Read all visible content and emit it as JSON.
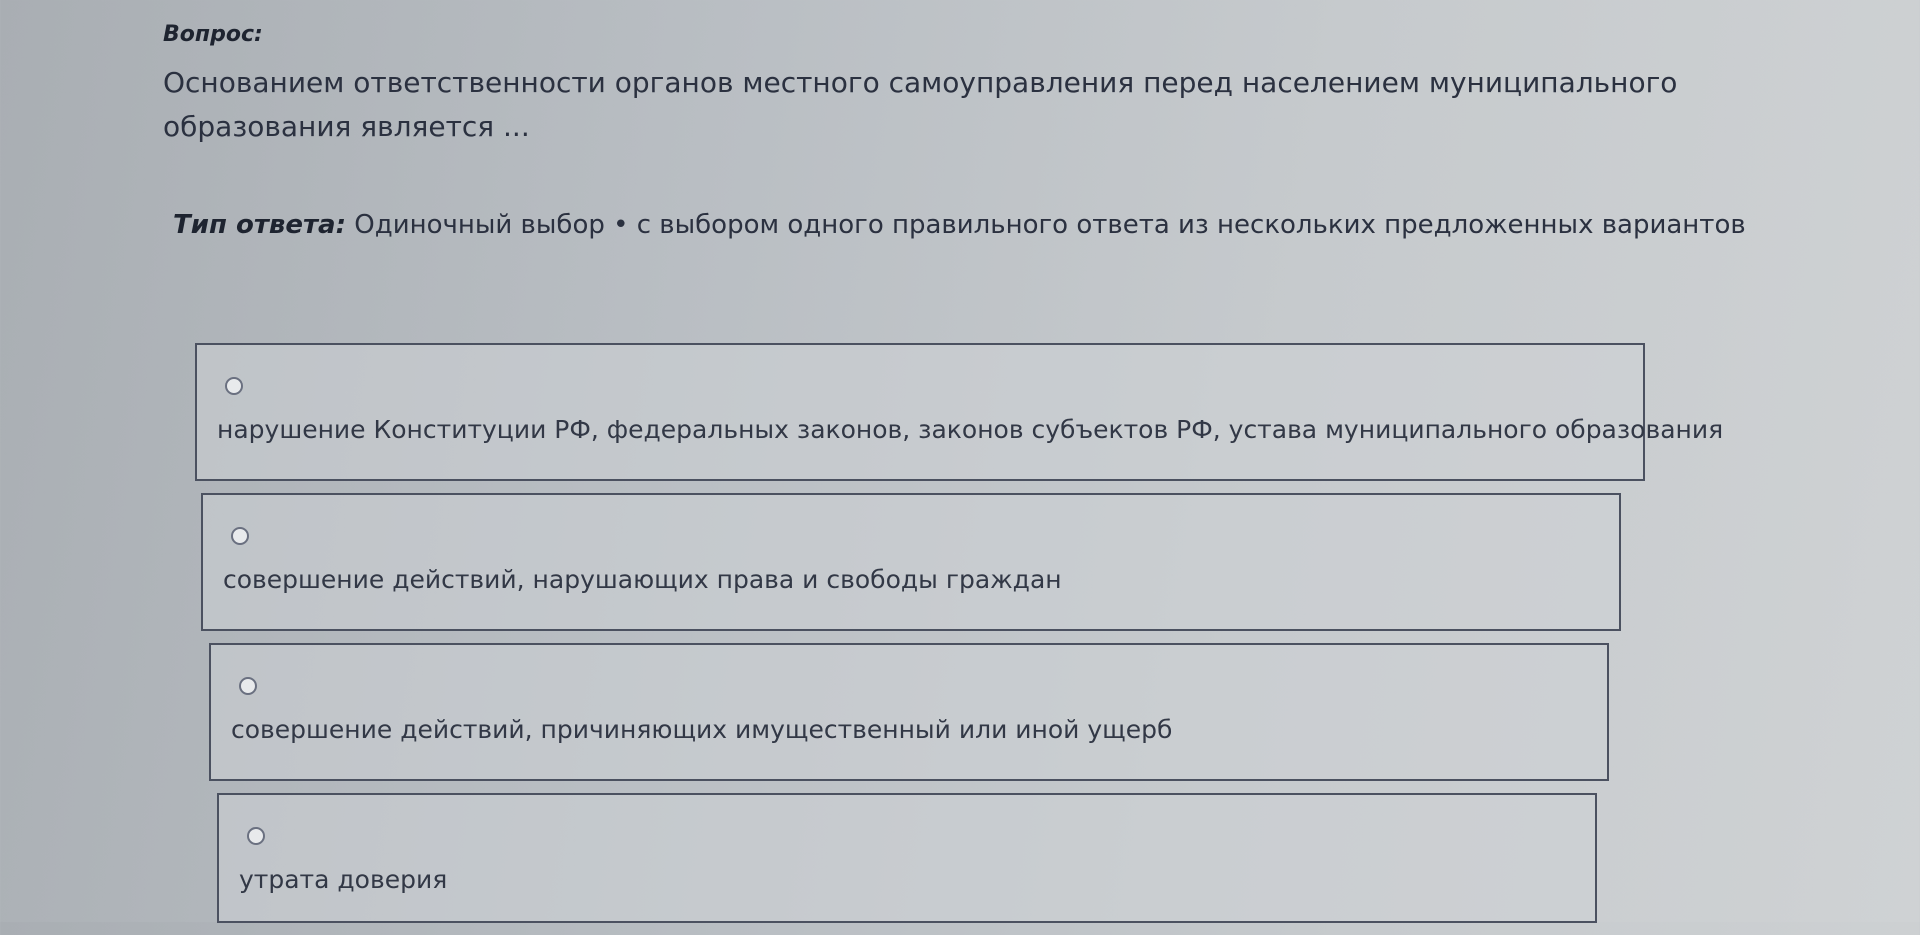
{
  "question": {
    "label": "Вопрос:",
    "text": "Основанием ответственности органов местного самоуправления перед населением муниципального образования является ..."
  },
  "answer_type": {
    "label": "Тип ответа:",
    "value": "Одиночный выбор • с выбором одного правильного ответа из нескольких предложенных вариантов"
  },
  "options": [
    {
      "label": "нарушение Конституции РФ, федеральных законов, законов субъектов РФ, устава муниципального образования",
      "selected": false
    },
    {
      "label": "совершение действий, нарушающих права и свободы граждан",
      "selected": false
    },
    {
      "label": "совершение действий, причиняющих имущественный или иной ущерб",
      "selected": false
    },
    {
      "label": "утрата доверия",
      "selected": false
    }
  ],
  "colors": {
    "text": "#2b3140",
    "border": "#4b5160"
  },
  "icons": {
    "radio": "radio-button-icon"
  }
}
